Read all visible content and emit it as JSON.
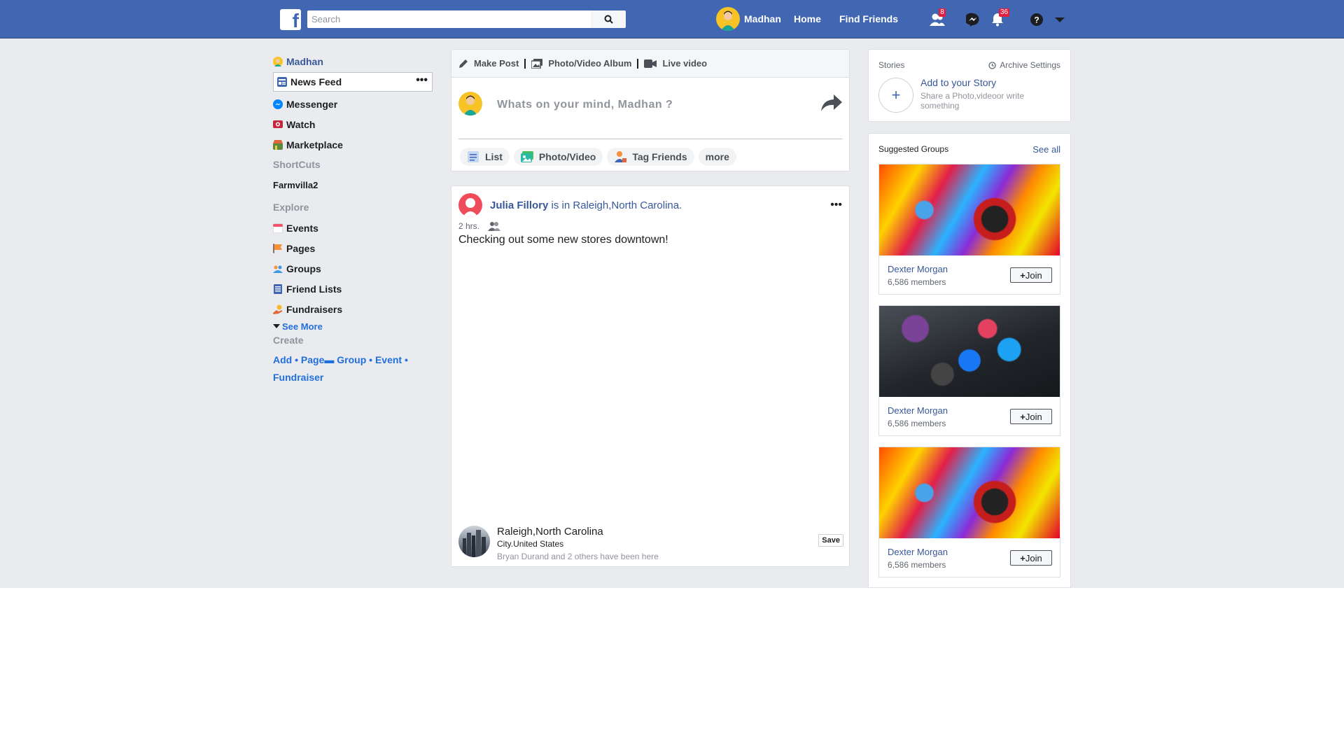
{
  "colors": {
    "brand": "#4267b2",
    "link": "#385898",
    "badge": "#e41e3f",
    "page_bg": "#e9ebee"
  },
  "topbar": {
    "search_placeholder": "Search",
    "user_name": "Madhan",
    "home_label": "Home",
    "find_friends_label": "Find Friends",
    "friend_requests_count": "8",
    "notifications_count": "36"
  },
  "sidebar": {
    "user_name": "Madhan",
    "items": [
      {
        "label": "News Feed",
        "icon": "news-feed-icon"
      },
      {
        "label": "Messenger",
        "icon": "messenger-icon"
      },
      {
        "label": "Watch",
        "icon": "watch-icon"
      },
      {
        "label": "Marketplace",
        "icon": "marketplace-icon"
      }
    ],
    "shortcuts_title": "ShortCuts",
    "shortcut_item": "Farmvilla2",
    "explore_title": "Explore",
    "explore_items": [
      {
        "label": "Events",
        "icon": "events-icon"
      },
      {
        "label": "Pages",
        "icon": "pages-icon"
      },
      {
        "label": "Groups",
        "icon": "groups-icon"
      },
      {
        "label": "Friend Lists",
        "icon": "friend-lists-icon"
      },
      {
        "label": "Fundraisers",
        "icon": "fundraisers-icon"
      }
    ],
    "see_more": "See More",
    "create_title": "Create",
    "create_links": [
      "Add",
      "Page",
      "Group",
      "Event",
      "Fundraiser"
    ]
  },
  "composer": {
    "tabs": [
      "Make Post",
      "Photo/Video Album",
      "Live video"
    ],
    "placeholder": "Whats on your mind, Madhan ?",
    "chips": [
      "List",
      "Photo/Video",
      "Tag Friends",
      "more"
    ]
  },
  "post": {
    "author": "Julia Fillory",
    "action": "is in Raleigh,North Carolina.",
    "time": "2 hrs.",
    "text": "Checking out some new stores downtown!",
    "location_title": "Raleigh,North Carolina",
    "location_sub": "City.United States",
    "location_note": "Bryan Durand and 2 others have been here",
    "save_label": "Save"
  },
  "stories": {
    "title": "Stories",
    "archive": "Archive Settings",
    "add_title": "Add to your Story",
    "add_sub": "Share a Photo,videoor write something"
  },
  "groups": {
    "title": "Suggested Groups",
    "see_all": "See all",
    "join_label": "Join",
    "cards": [
      {
        "name": "Dexter Morgan",
        "members": "6,586 members"
      },
      {
        "name": "Dexter Morgan",
        "members": "6,586 members"
      },
      {
        "name": "Dexter Morgan",
        "members": "6,586 members"
      }
    ]
  }
}
